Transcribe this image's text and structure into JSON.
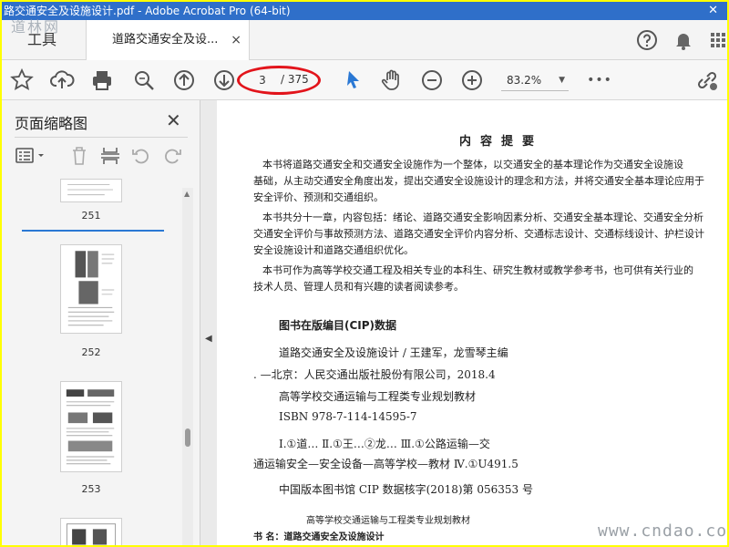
{
  "window": {
    "title": "路交通安全及设施设计.pdf - Adobe Acrobat Pro (64-bit)",
    "close_glyph": "✕",
    "logo_watermark": "道林网"
  },
  "tabs": {
    "tools_label": "工具",
    "doc_label": "道路交通安全及设...",
    "doc_close": "×"
  },
  "tabbar_right": {
    "help_icon": "help-icon",
    "bell_icon": "bell-icon",
    "grid_icon": "apps-grid-icon"
  },
  "toolbar": {
    "current_page": "3",
    "total_pages": "/ 375",
    "zoom": "83.2%",
    "more": "•••",
    "highlight_color": "#e2141b"
  },
  "left_panel": {
    "title": "页面缩略图",
    "close": "✕",
    "thumbnails": [
      {
        "label": "251"
      },
      {
        "label": "252"
      },
      {
        "label": "253"
      }
    ]
  },
  "document": {
    "heading": "内容提要",
    "paragraphs": [
      "本书将道路交通安全和交通安全设施作为一个整体，以交通安全的基本理论作为交通安全设施设",
      "基础，从主动交通安全角度出发，提出交通安全设施设计的理念和方法，并将交通安全基本理论应用于",
      "安全评价、预测和交通组织。",
      "本书共分十一章，内容包括：绪论、道路交通安全影响因素分析、交通安全基本理论、交通安全分析",
      "交通安全评价与事故预测方法、道路交通安全评价内容分析、交通标志设计、交通标线设计、护栏设计",
      "安全设施设计和道路交通组织优化。",
      "本书可作为高等学校交通工程及相关专业的本科生、研究生教材或教学参考书，也可供有关行业的",
      "技术人员、管理人员和有兴趣的读者阅读参考。"
    ],
    "cip_title": "图书在版编目(CIP)数据",
    "cip_lines": [
      "道路交通安全及设施设计 / 王建军，龙雪琴主编",
      ". —北京：人民交通出版社股份有限公司，2018.4",
      "高等学校交通运输与工程类专业规划教材",
      "ISBN  978-7-114-14595-7",
      "Ⅰ.①道…   Ⅱ.①王…②龙…   Ⅲ.①公路运输—交",
      "通运输安全—安全设备—高等学校—教材   Ⅳ.①U491.5",
      "中国版本图书馆 CIP 数据核字(2018)第 056353 号"
    ],
    "series": "高等学校交通运输与工程类专业规划教材",
    "book_name": "书      名：道路交通安全及设施设计"
  },
  "site_watermark": "www.cndao.com"
}
